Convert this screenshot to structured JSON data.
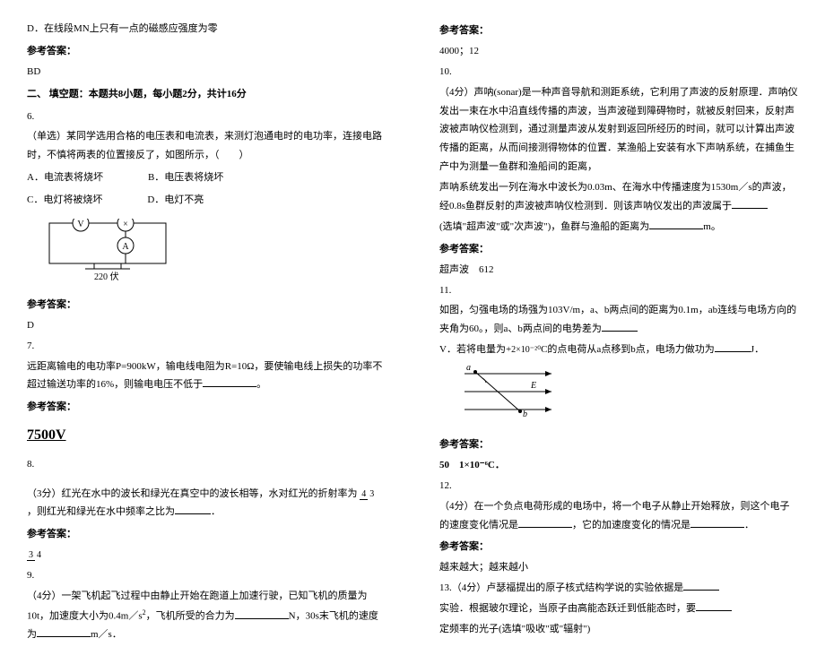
{
  "left": {
    "q5_optD": "D．在线段MN上只有一点的磁感应强度为零",
    "ans_label": "参考答案：",
    "q5_ans": "BD",
    "section2": "二、 填空题：本题共8小题，每小题2分，共计16分",
    "q6_num": "6.",
    "q6_text": "（单选）某同学选用合格的电压表和电流表，来测灯泡通电时的电功率，连接电路时，不慎将两表的位置接反了，如图所示，（　　）",
    "q6_optA": "A．电流表将烧坏",
    "q6_optB": "B．电压表将烧坏",
    "q6_optC": "C．电灯将被烧坏",
    "q6_optD": "D．电灯不亮",
    "circuit_label": "220 伏",
    "q6_ans": "D",
    "q7_num": "7.",
    "q7_text": "远距离输电的电功率P=900kW，输电线电阻为R=10Ω，要使输电线上损失的功率不超过输送功率的16%，则输电电压不低于",
    "q7_ans": "7500V",
    "q8_num": "8.",
    "q8_text_a": "（3分）红光在水中的波长和绿光在真空中的波长相等，水对红光的折射率为",
    "q8_frac_num": "4",
    "q8_frac_den": "3",
    "q8_text_b": "，则红光和绿光在水中频率之比为",
    "q8_text_c": "．",
    "q8_ans_num": "3",
    "q8_ans_den": "4",
    "q9_num": "9.",
    "q9_text_a": "（4分）一架飞机起飞过程中由静止开始在跑道上加速行驶，已知飞机的质量为10t，加速度大小为0.4m／s",
    "q9_sup": "2",
    "q9_text_b": "，飞机所受的合力为",
    "q9_text_c": "N，30s末飞机的速度为",
    "q9_text_d": "m／s．"
  },
  "right": {
    "ans_label": "参考答案：",
    "q9_ans": "4000；12",
    "q10_num": "10.",
    "q10_text_a": "（4分）声呐(sonar)是一种声音导航和测距系统，它利用了声波的反射原理．声呐仪发出一束在水中沿直线传播的声波，当声波碰到障碍物时，就被反射回来，反射声波被声呐仪检测到，通过测量声波从发射到返回所经历的时间，就可以计算出声波传播的距离，从而间接测得物体的位置．某渔船上安装有水下声呐系统，在捕鱼生产中为测量一鱼群和渔船间的距离，",
    "q10_text_b": "声呐系统发出一列在海水中波长为0.03m、在海水中传播速度为1530m／s的声波，经0.8s鱼群反射的声波被声呐仪检测到．则该声呐仪发出的声波属于",
    "q10_text_c": "(选填\"超声波\"或\"次声波\")，鱼群与渔船的距离为",
    "q10_text_d": "m。",
    "q10_ans": "超声波　612",
    "q11_num": "11.",
    "q11_text_a": "如图，匀强电场的场强为103V/m，a、b两点间的距离为0.1m，ab连线与电场方向的夹角为60。，则a、b两点间的电势差为",
    "q11_text_b": "V．若将电量为+",
    "q11_charge": "2×10⁻²⁰",
    "q11_text_c": "C的点电荷从a点移到b点，电场力做功为",
    "q11_text_d": "J．",
    "fig_a": "a",
    "fig_b": "b",
    "fig_E": "E",
    "q11_ans_a": "50",
    "q11_ans_b": "1×10⁻⁶C．",
    "q12_num": "12.",
    "q12_text_a": "（4分）在一个负点电荷形成的电场中，将一个电子从静止开始释放，则这个电子的速度变化情况是",
    "q12_text_b": "，它的加速度变化的情况是",
    "q12_text_c": "．",
    "q12_ans": "越来越大；越来越小",
    "q13_num": "13.",
    "q13_text_a": "（4分）卢瑟福提出的原子核式结构学说的实验依据是",
    "q13_text_b": "实验．根据玻尔理论，当原子由高能态跃迁到低能态时，要",
    "q13_text_c": "定频率的光子(选填\"吸收\"或\"辐射\")"
  }
}
